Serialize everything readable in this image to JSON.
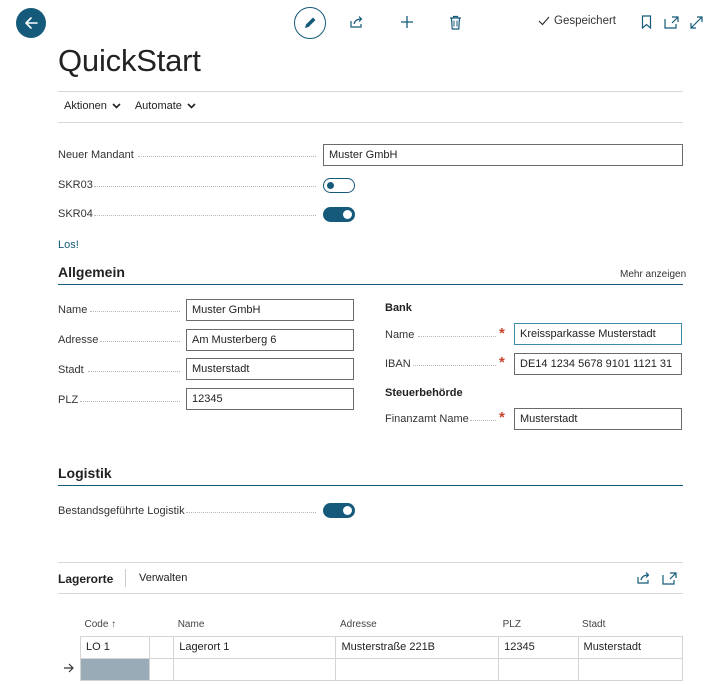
{
  "toolbar": {
    "saved_label": "Gespeichert"
  },
  "page": {
    "title": "QuickStart"
  },
  "actions": [
    {
      "label": "Aktionen"
    },
    {
      "label": "Automate"
    }
  ],
  "quickstart": {
    "new_client_label": "Neuer Mandant",
    "new_client_value": "Muster GmbH",
    "skr03_label": "SKR03",
    "skr03_on": false,
    "skr04_label": "SKR04",
    "skr04_on": true,
    "go_link": "Los!"
  },
  "general": {
    "title": "Allgemein",
    "show_more": "Mehr anzeigen",
    "left_fields": [
      {
        "label": "Name",
        "value": "Muster GmbH"
      },
      {
        "label": "Adresse",
        "value": "Am Musterberg 6"
      },
      {
        "label": "Stadt",
        "value": "Musterstadt"
      },
      {
        "label": "PLZ",
        "value": "12345"
      }
    ],
    "bank_heading": "Bank",
    "bank_name_label": "Name",
    "bank_name_value": "Kreissparkasse Musterstadt",
    "iban_label": "IBAN",
    "iban_value": "DE14 1234 5678 9101 1121 31",
    "tax_heading": "Steuerbehörde",
    "tax_office_label": "Finanzamt Name",
    "tax_office_value": "Musterstadt"
  },
  "logistics": {
    "title": "Logistik",
    "inventory_label": "Bestandsgeführte Logistik",
    "inventory_on": true
  },
  "locations": {
    "tab_label": "Lagerorte",
    "manage_label": "Verwalten",
    "columns": [
      "Code ↑",
      "Name",
      "Adresse",
      "PLZ",
      "Stadt"
    ],
    "rows": [
      {
        "code": "LO 1",
        "name": "Lagerort 1",
        "address": "Musterstraße 221B",
        "zip": "12345",
        "city": "Musterstadt"
      }
    ]
  }
}
